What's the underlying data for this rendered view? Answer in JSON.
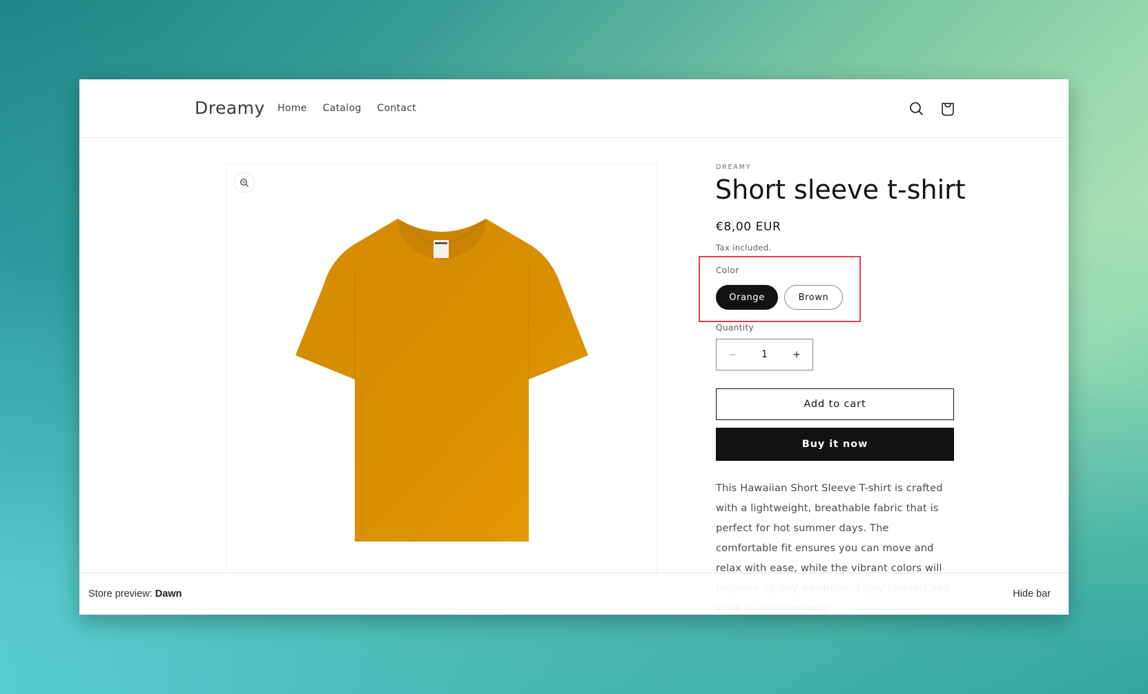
{
  "header": {
    "logo": "Dreamy",
    "nav": [
      {
        "label": "Home"
      },
      {
        "label": "Catalog"
      },
      {
        "label": "Contact"
      }
    ],
    "icons": {
      "search": "search-icon",
      "cart": "cart-bag-icon"
    }
  },
  "media": {
    "zoom_icon": "zoom-in-icon",
    "image_alt": "Orange short sleeve t-shirt",
    "shirt_color": "#dc9000"
  },
  "product": {
    "vendor": "DREAMY",
    "title": "Short sleeve t-shirt",
    "price": "€8,00 EUR",
    "tax_note": "Tax included.",
    "color_label": "Color",
    "colors": [
      {
        "label": "Orange",
        "selected": true
      },
      {
        "label": "Brown",
        "selected": false
      }
    ],
    "quantity_label": "Quantity",
    "quantity": "1",
    "minus": "−",
    "plus": "+",
    "add_to_cart": "Add to cart",
    "buy_now": "Buy it now",
    "description": "This Hawaiian Short Sleeve T-shirt is crafted with a lightweight, breathable fabric that is perfect for hot summer days. The comfortable fit ensures you can move and relax with ease, while the vibrant colors will brighten up any wardrobe. Enjoy comfort and style all summer long!"
  },
  "preview_bar": {
    "label": "Store preview:",
    "theme": "Dawn",
    "hide": "Hide bar"
  },
  "colors": {
    "highlight": "#ee3b4a",
    "primary": "#121212"
  }
}
